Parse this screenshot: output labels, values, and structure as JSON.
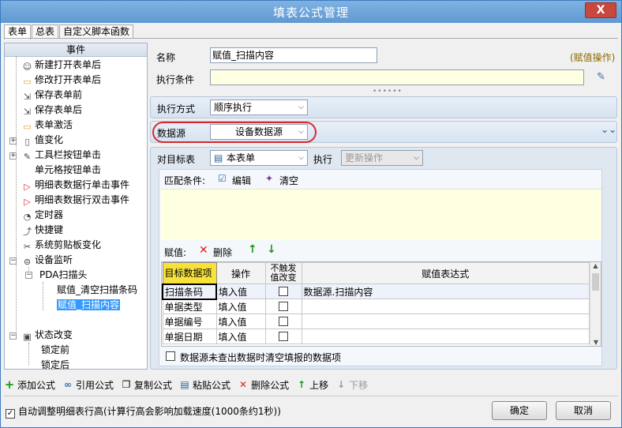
{
  "window": {
    "title": "填表公式管理",
    "close": "X"
  },
  "tabs": [
    "表单",
    "总表",
    "自定义脚本函数"
  ],
  "events": {
    "header": "事件",
    "items": [
      {
        "label": "新建打开表单后",
        "icon": "new-doc-icon"
      },
      {
        "label": "修改打开表单后",
        "icon": "folder-icon"
      },
      {
        "label": "保存表单前",
        "icon": "save-before-icon"
      },
      {
        "label": "保存表单后",
        "icon": "save-after-icon"
      },
      {
        "label": "表单激活",
        "icon": "folder-icon"
      },
      {
        "label": "值变化",
        "icon": "doc-icon"
      },
      {
        "label": "工具栏按钮单击",
        "icon": "wrench-icon"
      },
      {
        "label": "单元格按钮单击",
        "icon": "none"
      },
      {
        "label": "明细表数据行单击事件",
        "icon": "flag-icon"
      },
      {
        "label": "明细表数据行双击事件",
        "icon": "flag-icon"
      },
      {
        "label": "定时器",
        "icon": "timer-icon"
      },
      {
        "label": "快捷键",
        "icon": "shortcut-icon"
      },
      {
        "label": "系统剪贴板变化",
        "icon": "scissors-icon"
      },
      {
        "label": "设备监听",
        "icon": "device-icon"
      },
      {
        "label": "PDA扫描头",
        "icon": "none"
      },
      {
        "label": "赋值_清空扫描条码",
        "icon": "none"
      },
      {
        "label": "赋值_扫描内容",
        "icon": "none"
      },
      {
        "label": "状态改变",
        "icon": "state-icon"
      },
      {
        "label": "锁定前",
        "icon": "none"
      },
      {
        "label": "锁定后",
        "icon": "none"
      }
    ]
  },
  "form": {
    "name_label": "名称",
    "name_value": "赋值_扫描内容",
    "action_type": "(赋值操作)",
    "cond_label": "执行条件",
    "cond_value": "",
    "exec_mode_label": "执行方式",
    "exec_mode_value": "顺序执行",
    "datasource_label": "数据源",
    "datasource_value": "设备数据源",
    "target_label": "对目标表",
    "target_value": "本表单",
    "exec_label": "执行",
    "exec_value": "更新操作",
    "match_label": "匹配条件:",
    "edit_label": "编辑",
    "clear_label": "清空",
    "assign_label": "赋值:",
    "delete_label": "删除"
  },
  "table": {
    "headers": [
      "目标数据项",
      "操作",
      "不触发值改变",
      "赋值表达式"
    ],
    "rows": [
      [
        "扫描条码",
        "填入值",
        "",
        "数据源.扫描内容"
      ],
      [
        "单据类型",
        "填入值",
        "",
        ""
      ],
      [
        "单据编号",
        "填入值",
        "",
        ""
      ],
      [
        "单据日期",
        "填入值",
        "",
        ""
      ]
    ]
  },
  "clear_ds_label": "数据源未查出数据时清空填报的数据项",
  "toolbar": {
    "add": "添加公式",
    "ref": "引用公式",
    "copy": "复制公式",
    "paste": "粘贴公式",
    "del": "删除公式",
    "up": "上移",
    "down": "下移"
  },
  "footer": {
    "autoheight": "自动调整明细表行高(计算行高会影响加载速度(1000条约1秒))",
    "ok": "确定",
    "cancel": "取消"
  },
  "colors": {
    "selection": "#3399ff",
    "cond_bg": "#ffffe1",
    "highlight_circle": "#d9272e",
    "red_x": "#e02020",
    "green_arrow": "#1a9a1a"
  }
}
